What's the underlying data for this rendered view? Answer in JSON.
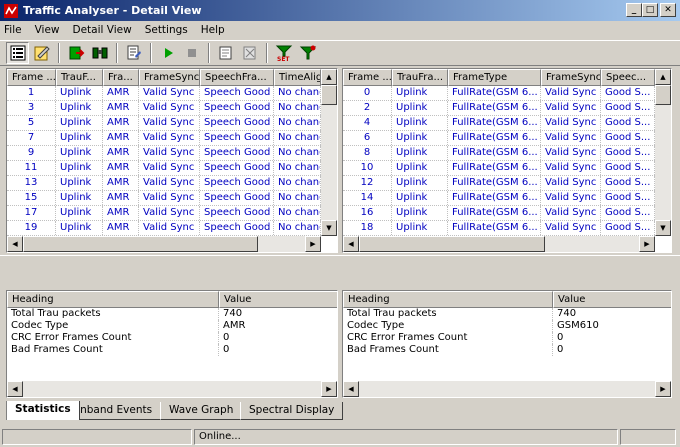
{
  "window": {
    "title": "Traffic Analyser - Detail View",
    "min": "_",
    "max": "□",
    "close": "✕"
  },
  "menu": [
    "File",
    "View",
    "Detail View",
    "Settings",
    "Help"
  ],
  "left_table": {
    "headers": [
      "Frame ...",
      "TrauF...",
      "Fra...",
      "FrameSync",
      "SpeechFra...",
      "TimeAlign"
    ],
    "rows": [
      [
        "1",
        "Uplink",
        "AMR",
        "Valid Sync",
        "Speech Good",
        "No chang"
      ],
      [
        "3",
        "Uplink",
        "AMR",
        "Valid Sync",
        "Speech Good",
        "No chang"
      ],
      [
        "5",
        "Uplink",
        "AMR",
        "Valid Sync",
        "Speech Good",
        "No chang"
      ],
      [
        "7",
        "Uplink",
        "AMR",
        "Valid Sync",
        "Speech Good",
        "No chang"
      ],
      [
        "9",
        "Uplink",
        "AMR",
        "Valid Sync",
        "Speech Good",
        "No chang"
      ],
      [
        "11",
        "Uplink",
        "AMR",
        "Valid Sync",
        "Speech Good",
        "No chang"
      ],
      [
        "13",
        "Uplink",
        "AMR",
        "Valid Sync",
        "Speech Good",
        "No chang"
      ],
      [
        "15",
        "Uplink",
        "AMR",
        "Valid Sync",
        "Speech Good",
        "No chang"
      ],
      [
        "17",
        "Uplink",
        "AMR",
        "Valid Sync",
        "Speech Good",
        "No chang"
      ],
      [
        "19",
        "Uplink",
        "AMR",
        "Valid Sync",
        "Speech Good",
        "No chang"
      ]
    ]
  },
  "right_table": {
    "headers": [
      "Frame ...",
      "TrauFra...",
      "FrameType",
      "FrameSync",
      "Speec..."
    ],
    "rows": [
      [
        "0",
        "Uplink",
        "FullRate(GSM 6...",
        "Valid Sync",
        "Good S..."
      ],
      [
        "2",
        "Uplink",
        "FullRate(GSM 6...",
        "Valid Sync",
        "Good S..."
      ],
      [
        "4",
        "Uplink",
        "FullRate(GSM 6...",
        "Valid Sync",
        "Good S..."
      ],
      [
        "6",
        "Uplink",
        "FullRate(GSM 6...",
        "Valid Sync",
        "Good S..."
      ],
      [
        "8",
        "Uplink",
        "FullRate(GSM 6...",
        "Valid Sync",
        "Good S..."
      ],
      [
        "10",
        "Uplink",
        "FullRate(GSM 6...",
        "Valid Sync",
        "Good S..."
      ],
      [
        "12",
        "Uplink",
        "FullRate(GSM 6...",
        "Valid Sync",
        "Good S..."
      ],
      [
        "14",
        "Uplink",
        "FullRate(GSM 6...",
        "Valid Sync",
        "Good S..."
      ],
      [
        "16",
        "Uplink",
        "FullRate(GSM 6...",
        "Valid Sync",
        "Good S..."
      ],
      [
        "18",
        "Uplink",
        "FullRate(GSM 6...",
        "Valid Sync",
        "Good S..."
      ]
    ]
  },
  "left_stats": {
    "headers": [
      "Heading",
      "Value"
    ],
    "rows": [
      [
        "Total Trau packets",
        "740"
      ],
      [
        "Codec Type",
        "AMR"
      ],
      [
        "CRC Error Frames Count",
        "0"
      ],
      [
        "Bad Frames Count",
        "0"
      ]
    ]
  },
  "right_stats": {
    "headers": [
      "Heading",
      "Value"
    ],
    "rows": [
      [
        "Total Trau packets",
        "740"
      ],
      [
        "Codec Type",
        "GSM610"
      ],
      [
        "CRC Error Frames Count",
        "0"
      ],
      [
        "Bad Frames Count",
        "0"
      ]
    ]
  },
  "tabs": [
    "Statistics",
    "Inband Events",
    "Wave Graph",
    "Spectral Display"
  ],
  "status": {
    "text": "Online..."
  },
  "colors": {
    "cell_text": "#0000c0",
    "title_start": "#0a246a",
    "title_end": "#a6caf0"
  }
}
